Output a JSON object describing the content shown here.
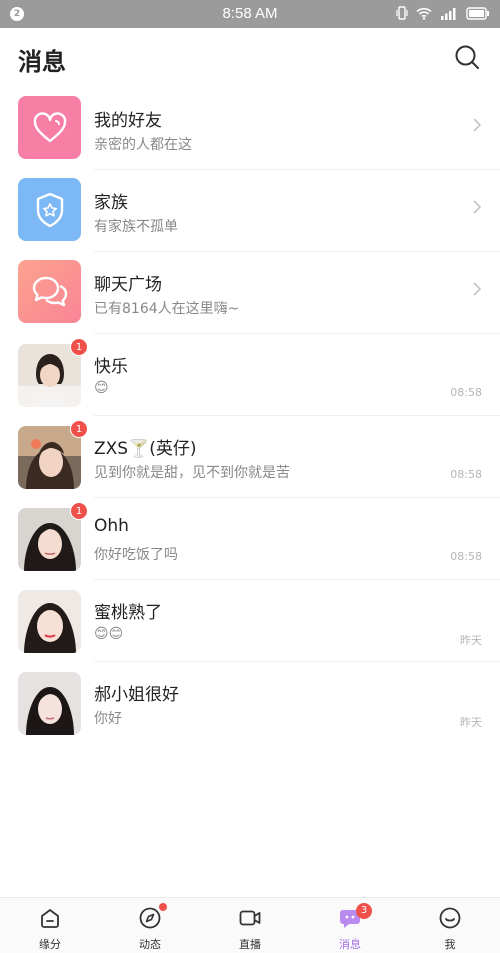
{
  "status_bar": {
    "notification_count": "2",
    "time": "8:58 AM"
  },
  "header": {
    "title": "消息"
  },
  "system_items": [
    {
      "name": "我的好友",
      "subtitle": "亲密的人都在这",
      "icon": "heart-icon",
      "color": "#f77fa6"
    },
    {
      "name": "家族",
      "subtitle": "有家族不孤单",
      "icon": "shield-star-icon",
      "color": "#7cb8f5"
    },
    {
      "name": "聊天广场",
      "subtitle": "已有8164人在这里嗨~",
      "icon": "chat-bubbles-icon",
      "color": "#fb8f84"
    }
  ],
  "conversations": [
    {
      "name": "快乐",
      "preview": "😊",
      "time": "08:58",
      "unread": "1"
    },
    {
      "name": "ZXS🍸(英仔)",
      "preview": "见到你就是甜，见不到你就是苦",
      "time": "08:58",
      "unread": "1"
    },
    {
      "name": "Ohh",
      "preview": "你好吃饭了吗",
      "time": "08:58",
      "unread": "1"
    },
    {
      "name": "蜜桃熟了",
      "preview": "😊😊",
      "time": "昨天",
      "unread": ""
    },
    {
      "name": "郝小姐很好",
      "preview": "你好",
      "time": "昨天",
      "unread": ""
    }
  ],
  "tabbar": {
    "tabs": [
      {
        "label": "缘分",
        "icon": "home-icon"
      },
      {
        "label": "动态",
        "icon": "compass-icon"
      },
      {
        "label": "直播",
        "icon": "video-camera-icon"
      },
      {
        "label": "消息",
        "icon": "message-bubble-icon"
      },
      {
        "label": "我",
        "icon": "smiley-face-icon"
      }
    ],
    "messages_badge": "3",
    "accent": "#a46ee8"
  }
}
